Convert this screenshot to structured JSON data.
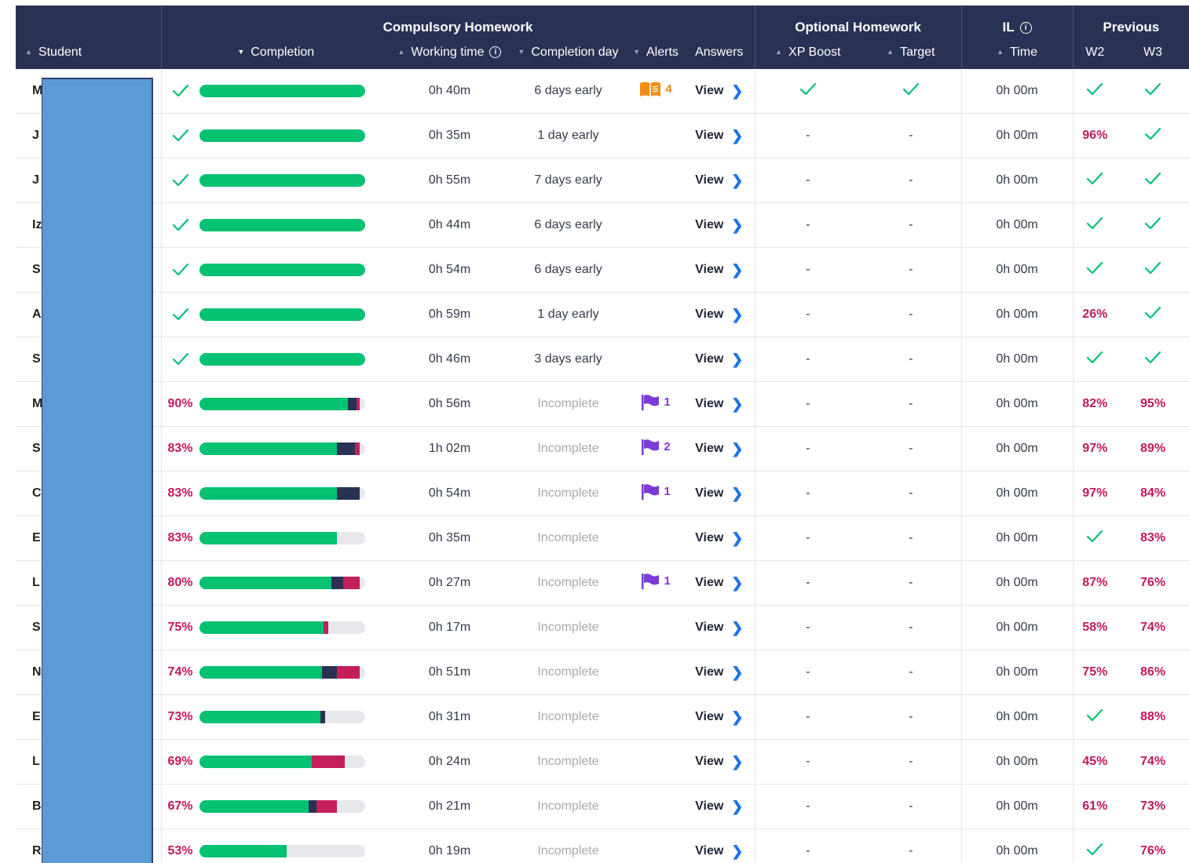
{
  "header": {
    "groups": {
      "compulsory": "Compulsory Homework",
      "optional": "Optional Homework",
      "il": "IL",
      "previous": "Previous"
    },
    "columns": {
      "student": "Student",
      "completion": "Completion",
      "working_time": "Working time",
      "completion_day": "Completion day",
      "alerts": "Alerts",
      "answers": "Answers",
      "xp_boost": "XP Boost",
      "target": "Target",
      "time": "Time",
      "w2": "W2",
      "w3": "W3"
    }
  },
  "colors": {
    "header_bg": "#293254",
    "bar_green": "#05c172",
    "bar_navy": "#293254",
    "bar_red": "#c41f5b",
    "percent_red": "#c2185b",
    "alert_flag": "#7a3bd6",
    "alert_book": "#f28c13",
    "redaction": "#5b9bd5"
  },
  "icons": {
    "check": "check-icon",
    "info": "info-icon",
    "flag": "flag-icon",
    "book": "book-icon",
    "chevron": "chevron-right-icon",
    "sort": "sort-caret-icon"
  },
  "rows": [
    {
      "initial": "M",
      "pct": null,
      "bar": {
        "green": 1.0,
        "navy": 0,
        "red": 0
      },
      "working": "0h 40m",
      "day": "6 days early",
      "incomplete": false,
      "alert": {
        "type": "book",
        "count": "4"
      },
      "answers": "View",
      "xp": "check",
      "target": "check",
      "time": "0h 00m",
      "w2": "check",
      "w3": "check"
    },
    {
      "initial": "J",
      "pct": null,
      "bar": {
        "green": 1.0,
        "navy": 0,
        "red": 0
      },
      "working": "0h 35m",
      "day": "1 day early",
      "incomplete": false,
      "alert": null,
      "answers": "View",
      "xp": "-",
      "target": "-",
      "time": "0h 00m",
      "w2": "96%",
      "w3": "check"
    },
    {
      "initial": "J",
      "pct": null,
      "bar": {
        "green": 1.0,
        "navy": 0,
        "red": 0
      },
      "working": "0h 55m",
      "day": "7 days early",
      "incomplete": false,
      "alert": null,
      "answers": "View",
      "xp": "-",
      "target": "-",
      "time": "0h 00m",
      "w2": "check",
      "w3": "check"
    },
    {
      "initial": "Iz",
      "pct": null,
      "bar": {
        "green": 1.0,
        "navy": 0,
        "red": 0
      },
      "working": "0h 44m",
      "day": "6 days early",
      "incomplete": false,
      "alert": null,
      "answers": "View",
      "xp": "-",
      "target": "-",
      "time": "0h 00m",
      "w2": "check",
      "w3": "check"
    },
    {
      "initial": "S",
      "pct": null,
      "bar": {
        "green": 1.0,
        "navy": 0,
        "red": 0
      },
      "working": "0h 54m",
      "day": "6 days early",
      "incomplete": false,
      "alert": null,
      "answers": "View",
      "xp": "-",
      "target": "-",
      "time": "0h 00m",
      "w2": "check",
      "w3": "check"
    },
    {
      "initial": "A",
      "pct": null,
      "bar": {
        "green": 1.0,
        "navy": 0,
        "red": 0
      },
      "working": "0h 59m",
      "day": "1 day early",
      "incomplete": false,
      "alert": null,
      "answers": "View",
      "xp": "-",
      "target": "-",
      "time": "0h 00m",
      "w2": "26%",
      "w3": "check"
    },
    {
      "initial": "S",
      "pct": null,
      "bar": {
        "green": 1.0,
        "navy": 0,
        "red": 0
      },
      "working": "0h 46m",
      "day": "3 days early",
      "incomplete": false,
      "alert": null,
      "answers": "View",
      "xp": "-",
      "target": "-",
      "time": "0h 00m",
      "w2": "check",
      "w3": "check"
    },
    {
      "initial": "M",
      "pct": "90%",
      "bar": {
        "green": 0.9,
        "navy": 0.05,
        "red": 0.02
      },
      "working": "0h 56m",
      "day": "Incomplete",
      "incomplete": true,
      "alert": {
        "type": "flag",
        "count": "1"
      },
      "answers": "View",
      "xp": "-",
      "target": "-",
      "time": "0h 00m",
      "w2": "82%",
      "w3": "95%"
    },
    {
      "initial": "S",
      "pct": "83%",
      "bar": {
        "green": 0.83,
        "navy": 0.11,
        "red": 0.03
      },
      "working": "1h 02m",
      "day": "Incomplete",
      "incomplete": true,
      "alert": {
        "type": "flag",
        "count": "2"
      },
      "answers": "View",
      "xp": "-",
      "target": "-",
      "time": "0h 00m",
      "w2": "97%",
      "w3": "89%"
    },
    {
      "initial": "C",
      "pct": "83%",
      "bar": {
        "green": 0.83,
        "navy": 0.14,
        "red": 0
      },
      "working": "0h 54m",
      "day": "Incomplete",
      "incomplete": true,
      "alert": {
        "type": "flag",
        "count": "1"
      },
      "answers": "View",
      "xp": "-",
      "target": "-",
      "time": "0h 00m",
      "w2": "97%",
      "w3": "84%"
    },
    {
      "initial": "E",
      "pct": "83%",
      "bar": {
        "green": 0.83,
        "navy": 0,
        "red": 0
      },
      "working": "0h 35m",
      "day": "Incomplete",
      "incomplete": true,
      "alert": null,
      "answers": "View",
      "xp": "-",
      "target": "-",
      "time": "0h 00m",
      "w2": "check",
      "w3": "83%"
    },
    {
      "initial": "L",
      "pct": "80%",
      "bar": {
        "green": 0.8,
        "navy": 0.07,
        "red": 0.1
      },
      "working": "0h 27m",
      "day": "Incomplete",
      "incomplete": true,
      "alert": {
        "type": "flag",
        "count": "1"
      },
      "answers": "View",
      "xp": "-",
      "target": "-",
      "time": "0h 00m",
      "w2": "87%",
      "w3": "76%"
    },
    {
      "initial": "S",
      "pct": "75%",
      "bar": {
        "green": 0.75,
        "navy": 0,
        "red": 0.03
      },
      "working": "0h 17m",
      "day": "Incomplete",
      "incomplete": true,
      "alert": null,
      "answers": "View",
      "xp": "-",
      "target": "-",
      "time": "0h 00m",
      "w2": "58%",
      "w3": "74%"
    },
    {
      "initial": "N",
      "pct": "74%",
      "bar": {
        "green": 0.74,
        "navy": 0.09,
        "red": 0.14
      },
      "working": "0h 51m",
      "day": "Incomplete",
      "incomplete": true,
      "alert": null,
      "answers": "View",
      "xp": "-",
      "target": "-",
      "time": "0h 00m",
      "w2": "75%",
      "w3": "86%"
    },
    {
      "initial": "E",
      "pct": "73%",
      "bar": {
        "green": 0.73,
        "navy": 0.03,
        "red": 0
      },
      "working": "0h 31m",
      "day": "Incomplete",
      "incomplete": true,
      "alert": null,
      "answers": "View",
      "xp": "-",
      "target": "-",
      "time": "0h 00m",
      "w2": "check",
      "w3": "88%"
    },
    {
      "initial": "L",
      "pct": "69%",
      "bar": {
        "green": 0.68,
        "navy": 0,
        "red": 0.2
      },
      "working": "0h 24m",
      "day": "Incomplete",
      "incomplete": true,
      "alert": null,
      "answers": "View",
      "xp": "-",
      "target": "-",
      "time": "0h 00m",
      "w2": "45%",
      "w3": "74%"
    },
    {
      "initial": "B",
      "pct": "67%",
      "bar": {
        "green": 0.66,
        "navy": 0.05,
        "red": 0.12
      },
      "working": "0h 21m",
      "day": "Incomplete",
      "incomplete": true,
      "alert": null,
      "answers": "View",
      "xp": "-",
      "target": "-",
      "time": "0h 00m",
      "w2": "61%",
      "w3": "73%"
    },
    {
      "initial": "R",
      "pct": "53%",
      "bar": {
        "green": 0.53,
        "navy": 0,
        "red": 0
      },
      "working": "0h 19m",
      "day": "Incomplete",
      "incomplete": true,
      "alert": null,
      "answers": "View",
      "xp": "-",
      "target": "-",
      "time": "0h 00m",
      "w2": "check",
      "w3": "76%"
    }
  ]
}
